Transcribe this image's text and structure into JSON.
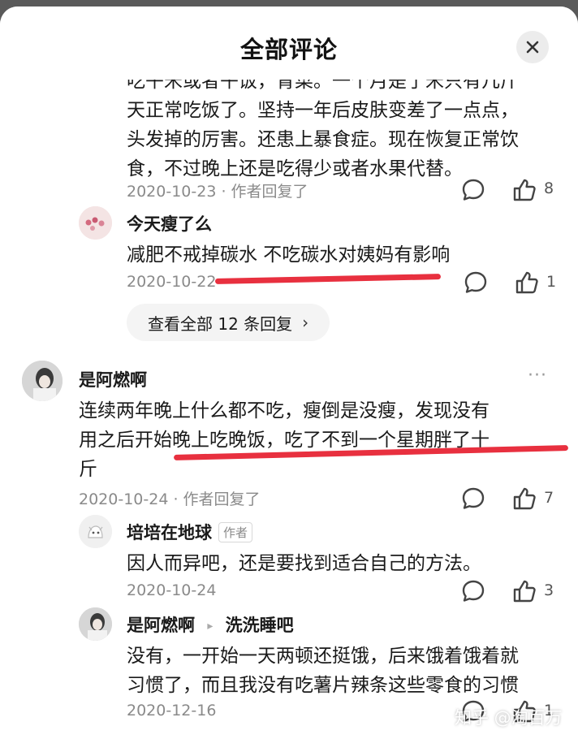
{
  "header": {
    "title": "全部评论"
  },
  "c1": {
    "lines": [
      "吃午米或者午饭，青菜。一个月是了米只有几斤",
      "天正常吃饭了。坚持一年后皮肤变差了一点点，",
      "头发掉的厉害。还患上暴食症。现在恢复正常饮",
      "食，不过晚上还是吃得少或者水果代替。"
    ],
    "meta": "2020-10-23 · 作者回复了",
    "likes": "8"
  },
  "r1": {
    "name": "今天瘦了么",
    "text": "减肥不戒掉碳水 不吃碳水对姨妈有影响",
    "meta": "2020-10-22",
    "likes": "1"
  },
  "view_all": {
    "label": "查看全部 12 条回复",
    "chevron": "›"
  },
  "c2": {
    "name": "是阿燃啊",
    "more": "···",
    "lines": [
      "连续两年晚上什么都不吃，瘦倒是没瘦，发现没有",
      "用之后开始晚上吃晚饭，吃了不到一个星期胖了十",
      "斤"
    ],
    "meta": "2020-10-24 · 作者回复了",
    "likes": "7"
  },
  "r2": {
    "name": "培培在地球",
    "tag": "作者",
    "text": "因人而异吧，还是要找到适合自己的方法。",
    "meta": "2020-10-24",
    "likes": "3"
  },
  "r3": {
    "name": "是阿燃啊",
    "arrow": "▸",
    "reply_to": "洗洗睡吧",
    "lines": [
      "没有，一开始一天两顿还挺饿，后来饿着饿着就",
      "习惯了，而且我没有吃薯片辣条这些零食的习惯"
    ],
    "meta": "2020-12-16",
    "likes": "1"
  },
  "watermark": "知乎 @淘百万",
  "icons": {
    "comment": "comment-icon",
    "like": "thumbs-up-icon",
    "close": "close-icon"
  },
  "colors": {
    "underline": "#e8303f",
    "meta": "#8a8a8a"
  }
}
